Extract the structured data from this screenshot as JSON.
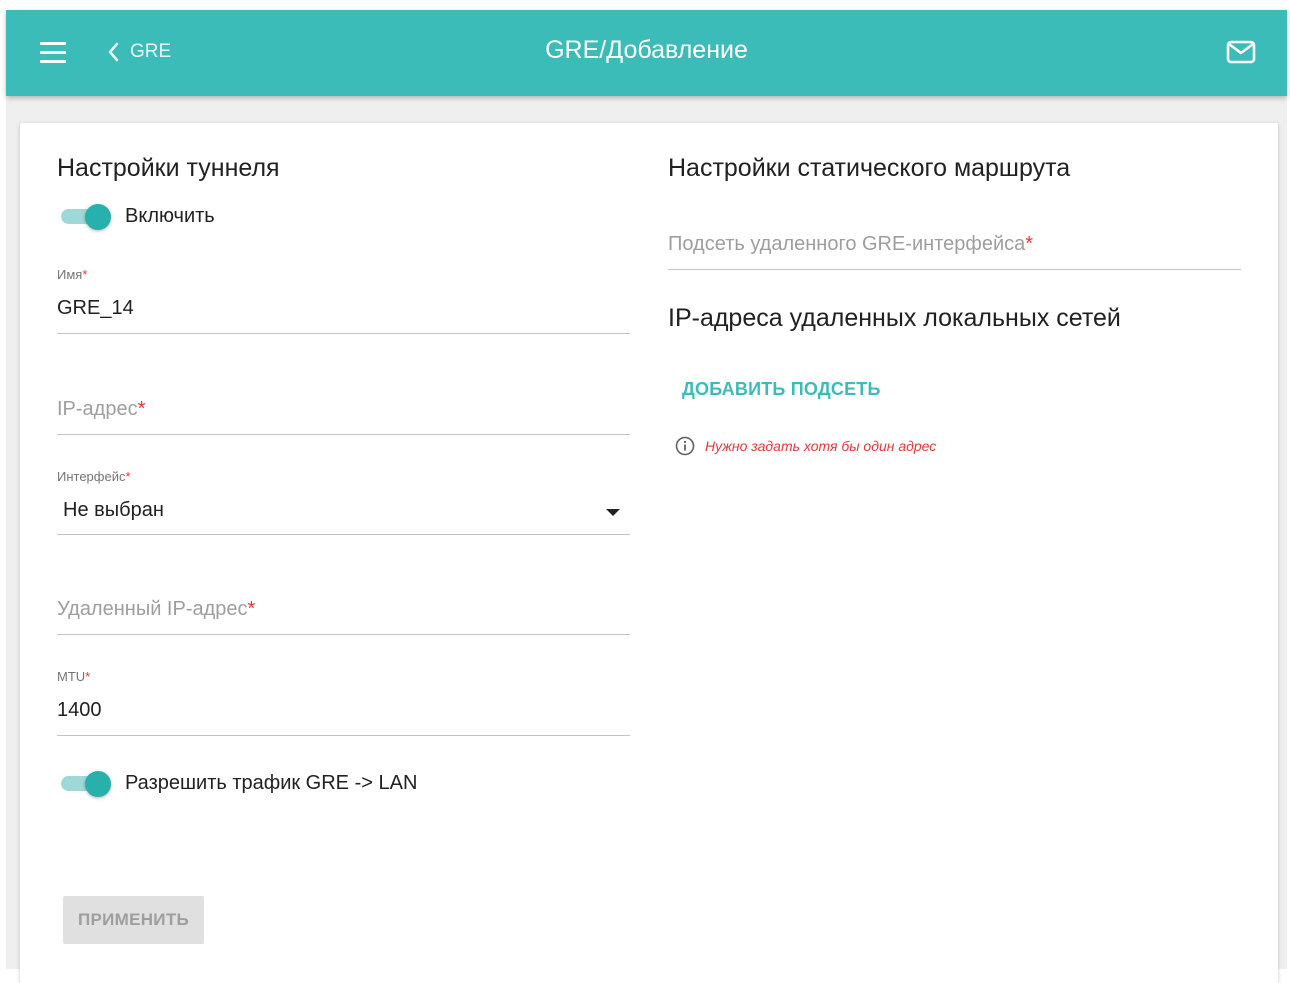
{
  "header": {
    "back_label": "GRE",
    "title": "GRE/Добавление",
    "icons": {
      "menu": "menu-icon",
      "back": "chevron-left-icon",
      "mail": "mail-icon"
    }
  },
  "tunnel": {
    "title": "Настройки туннеля",
    "enable_label": "Включить",
    "enable_on": true,
    "name": {
      "label": "Имя",
      "value": "GRE_14"
    },
    "ip": {
      "placeholder": "IP-адрес"
    },
    "interface": {
      "label": "Интерфейс",
      "value": "Не выбран"
    },
    "remote_ip": {
      "placeholder": "Удаленный IP-адрес"
    },
    "mtu": {
      "label": "MTU",
      "value": "1400"
    },
    "allow_traffic_label": "Разрешить трафик GRE -> LAN",
    "allow_traffic_on": true,
    "apply_label": "ПРИМЕНИТЬ"
  },
  "route": {
    "title": "Настройки статического маршрута",
    "remote_subnet": {
      "placeholder": "Подсеть удаленного GRE-интерфейса"
    },
    "lan_title": "IP-адреса удаленных локальных сетей",
    "add_subnet_label": "ДОБАВИТЬ ПОДСЕТЬ",
    "hint": "Нужно задать хотя бы один адрес"
  },
  "required_mark": "*",
  "colors": {
    "accent": "#3cbcb8",
    "error": "#e53935",
    "toggle_on": "#28b0ac"
  }
}
